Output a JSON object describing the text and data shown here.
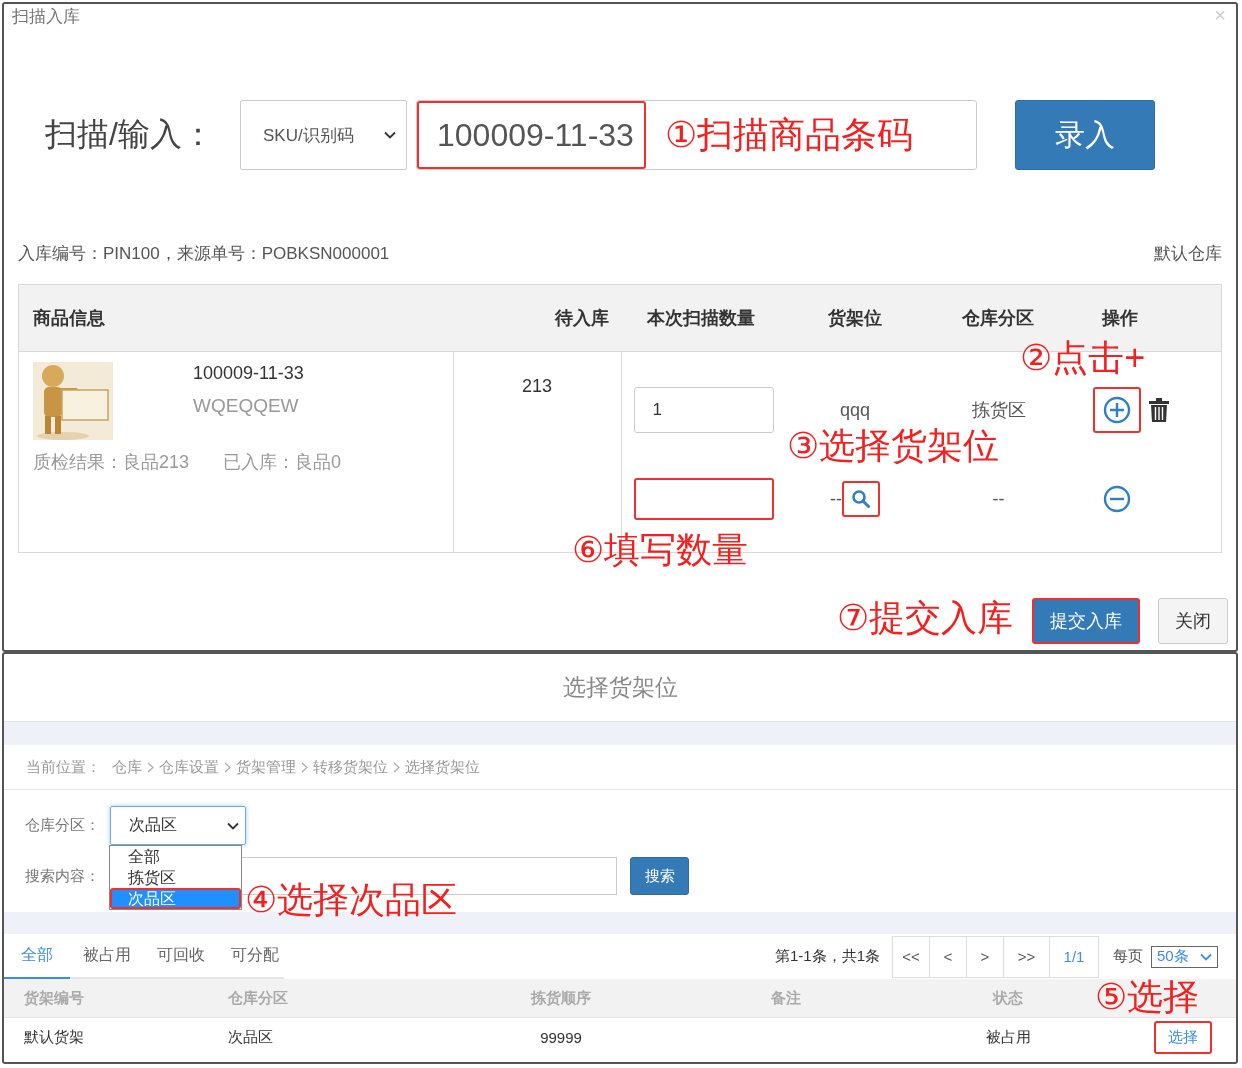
{
  "scan_dialog": {
    "title": "扫描入库",
    "close": "×",
    "scan": {
      "label": "扫描/输入：",
      "type_select": "SKU/识别码",
      "value": "100009-11-33",
      "value_highlighted": true,
      "submit": "录入"
    },
    "info": {
      "text": "入库编号：PIN100，来源单号：POBKSN000001",
      "warehouse": "默认仓库"
    },
    "table": {
      "columns": [
        "商品信息",
        "待入库",
        "本次扫描数量",
        "货架位",
        "仓库分区",
        "操作"
      ],
      "rows": [
        {
          "image": {
            "kind": "picture"
          },
          "code": "100009-11-33",
          "name": "WQEQQEW",
          "quality": "质检结果：良品213",
          "received": "已入库：良品0",
          "pending": "213",
          "locations": [
            {
              "quantity": "1",
              "quantity_highlighted": false,
              "shelf": "qqq",
              "zone": "拣货区",
              "kind": "add",
              "action_highlighted": true
            },
            {
              "quantity_highlighted": true,
              "shelf": "--",
              "shelf_picker": {
                "highlighted": true
              },
              "zone": "--",
              "kind": "remove",
              "action_highlighted": false
            }
          ]
        }
      ]
    },
    "buttons": [
      {
        "label": "提交入库",
        "kind": "primary",
        "highlighted": true
      },
      {
        "label": "关闭",
        "kind": "default",
        "highlighted": false
      }
    ]
  },
  "shelf_dialog": {
    "title": "选择货架位",
    "breadcrumb": {
      "label": "当前位置：",
      "items": [
        "仓库",
        "仓库设置",
        "货架管理",
        "转移货架位",
        "选择货架位"
      ]
    },
    "filters": {
      "zone_label": "仓库分区：",
      "zone_value": "次品区",
      "zone_options": [
        {
          "label": "全部",
          "selected": false,
          "highlighted": false
        },
        {
          "label": "拣货区",
          "selected": false,
          "highlighted": false
        },
        {
          "label": "次品区",
          "selected": true,
          "highlighted": true
        }
      ],
      "search_label": "搜索内容：",
      "search_button": "搜索"
    },
    "tabs": [
      {
        "label": "全部",
        "selected": true
      },
      {
        "label": "被占用",
        "selected": false
      },
      {
        "label": "可回收",
        "selected": false
      },
      {
        "label": "可分配",
        "selected": false
      }
    ],
    "pager": {
      "summary": "第1-1条，共1条",
      "buttons": [
        "<<",
        "<",
        ">",
        ">>"
      ],
      "page": "1/1",
      "per_page_label": "每页",
      "per_page": "50条"
    },
    "table": {
      "columns": [
        "货架编号",
        "仓库分区",
        "拣货顺序",
        "备注",
        "状态"
      ],
      "rows": [
        {
          "shelf": "默认货架",
          "zone": "次品区",
          "order": "99999",
          "status": "被占用",
          "action": "选择",
          "action_highlighted": true
        }
      ]
    }
  },
  "annotations": [
    {
      "text": "①扫描商品条码"
    },
    {
      "text": "②点击+"
    },
    {
      "text": "③选择货架位"
    },
    {
      "text": "④选择次品区"
    },
    {
      "text": "⑤选择"
    },
    {
      "text": "⑥填写数量"
    },
    {
      "text": "⑦提交入库"
    }
  ]
}
